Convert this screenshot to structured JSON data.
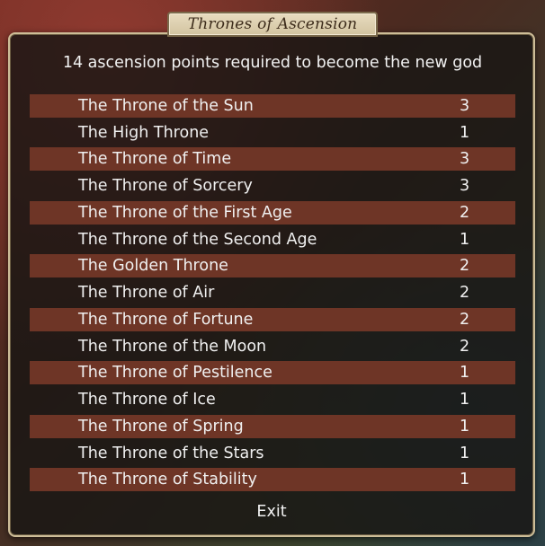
{
  "dialog": {
    "title": "Thrones of Ascension",
    "header": "14 ascension points required to become the new god",
    "exit_label": "Exit"
  },
  "thrones": [
    {
      "name": "The Throne of the Sun",
      "points": "3"
    },
    {
      "name": "The High Throne",
      "points": "1"
    },
    {
      "name": "The Throne of Time",
      "points": "3"
    },
    {
      "name": "The Throne of Sorcery",
      "points": "3"
    },
    {
      "name": "The Throne of the First Age",
      "points": "2"
    },
    {
      "name": "The Throne of the Second Age",
      "points": "1"
    },
    {
      "name": "The Golden Throne",
      "points": "2"
    },
    {
      "name": "The Throne of Air",
      "points": "2"
    },
    {
      "name": "The Throne of Fortune",
      "points": "2"
    },
    {
      "name": "The Throne of the Moon",
      "points": "2"
    },
    {
      "name": "The Throne of Pestilence",
      "points": "1"
    },
    {
      "name": "The Throne of Ice",
      "points": "1"
    },
    {
      "name": "The Throne of Spring",
      "points": "1"
    },
    {
      "name": "The Throne of the Stars",
      "points": "1"
    },
    {
      "name": "The Throne of Stability",
      "points": "1"
    }
  ],
  "colors": {
    "shaded_row": "#6e3526",
    "panel_border": "#cdbd98",
    "text": "#f0f0f0"
  }
}
